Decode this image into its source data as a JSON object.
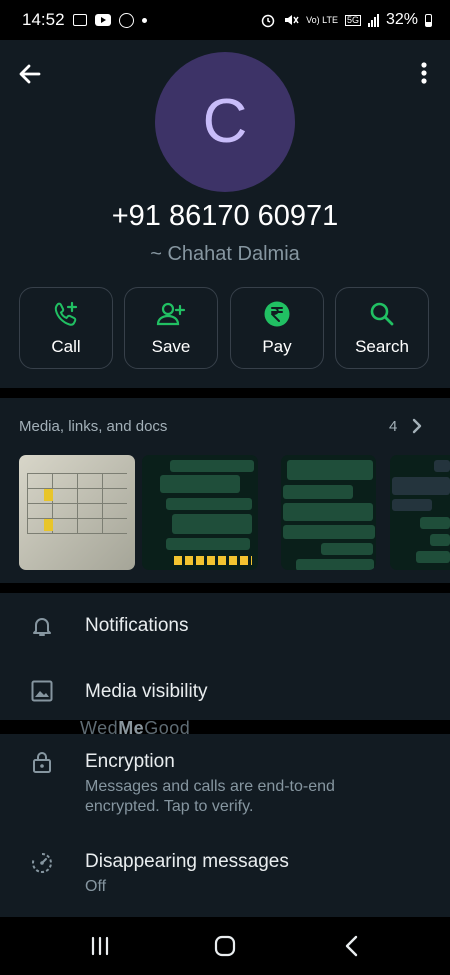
{
  "status_bar": {
    "time": "14:52",
    "network_small": "Vo) LTE",
    "network_5g": "5G",
    "battery": "32%"
  },
  "header": {
    "avatar_letter": "C",
    "phone_number": "+91 86170 60971",
    "contact_name": "~ Chahat Dalmia"
  },
  "actions": [
    {
      "label": "Call",
      "icon": "call-add-icon"
    },
    {
      "label": "Save",
      "icon": "add-person-icon"
    },
    {
      "label": "Pay",
      "icon": "rupee-icon"
    },
    {
      "label": "Search",
      "icon": "search-icon"
    }
  ],
  "media": {
    "title": "Media, links, and docs",
    "count": "4"
  },
  "settings": [
    {
      "title": "Notifications",
      "icon": "bell-icon"
    },
    {
      "title": "Media visibility",
      "icon": "image-icon"
    }
  ],
  "watermark": {
    "pre": "Wed",
    "mid": "Me",
    "post": "Good"
  },
  "encryption": {
    "title": "Encryption",
    "subtitle": "Messages and calls are end-to-end encrypted. Tap to verify.",
    "icon": "lock-icon"
  },
  "disappearing": {
    "title": "Disappearing messages",
    "value": "Off",
    "icon": "timer-icon"
  },
  "colors": {
    "accent": "#21c063",
    "panel": "#121b22",
    "avatar_bg": "#3d3367"
  }
}
